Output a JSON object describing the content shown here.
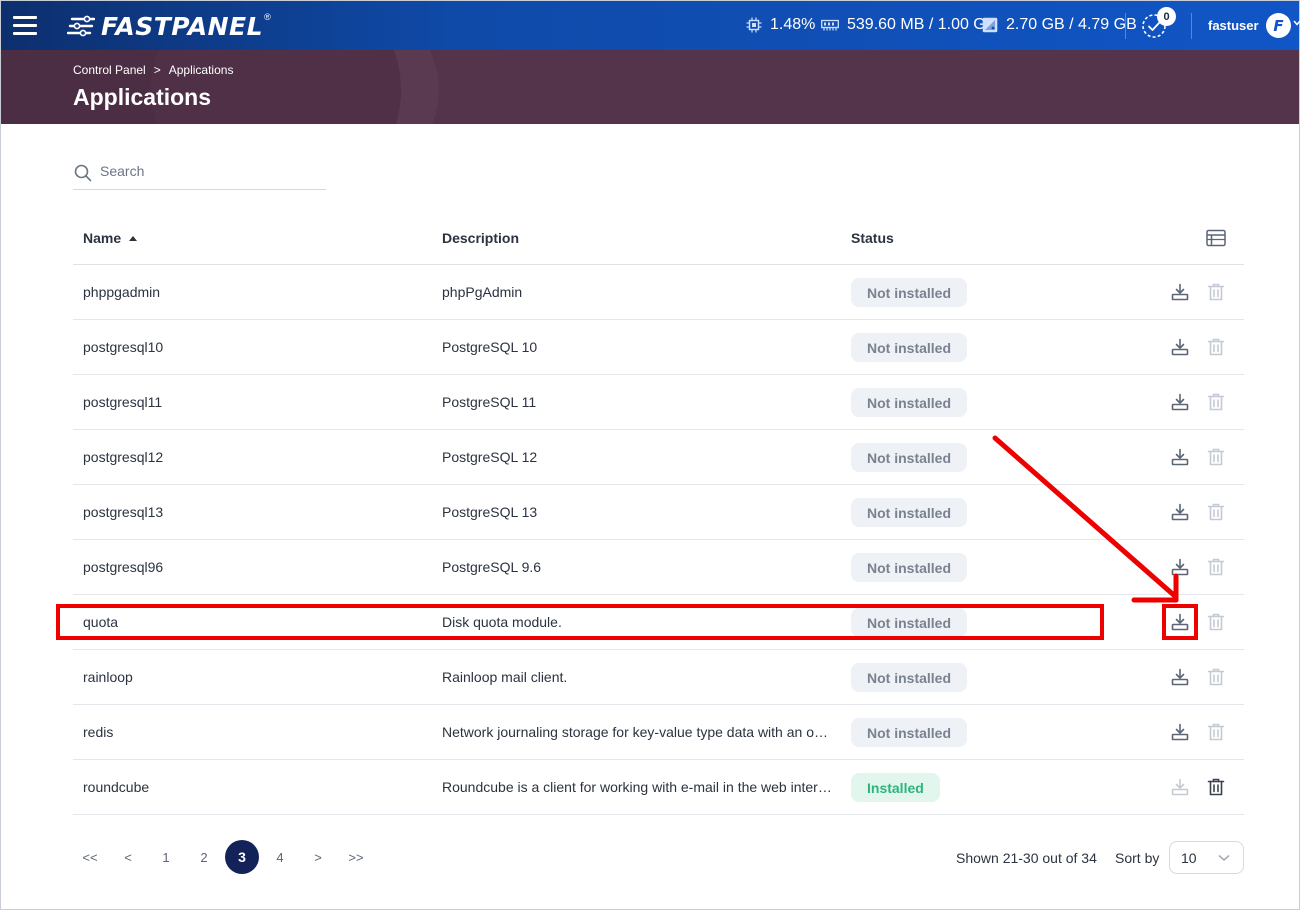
{
  "topbar": {
    "logo_text": "FASTPANEL",
    "logo_mark": "®",
    "cpu": "1.48%",
    "memory": "539.60 MB / 1.00 GB",
    "disk": "2.70 GB / 4.79 GB",
    "tasks_count": "0",
    "user_name": "fastuser",
    "avatar_letter": "F"
  },
  "breadcrumb": {
    "root": "Control Panel",
    "separator": ">",
    "current": "Applications"
  },
  "page_title": "Applications",
  "search": {
    "placeholder": "Search",
    "value": ""
  },
  "table": {
    "headers": {
      "name": "Name",
      "description": "Description",
      "status": "Status"
    },
    "rows": [
      {
        "name": "phppgadmin",
        "description": "phpPgAdmin",
        "status": "Not installed"
      },
      {
        "name": "postgresql10",
        "description": "PostgreSQL 10",
        "status": "Not installed"
      },
      {
        "name": "postgresql11",
        "description": "PostgreSQL 11",
        "status": "Not installed"
      },
      {
        "name": "postgresql12",
        "description": "PostgreSQL 12",
        "status": "Not installed"
      },
      {
        "name": "postgresql13",
        "description": "PostgreSQL 13",
        "status": "Not installed"
      },
      {
        "name": "postgresql96",
        "description": "PostgreSQL 9.6",
        "status": "Not installed"
      },
      {
        "name": "quota",
        "description": "Disk quota module.",
        "status": "Not installed"
      },
      {
        "name": "rainloop",
        "description": "Rainloop mail client.",
        "status": "Not installed"
      },
      {
        "name": "redis",
        "description": "Network journaling storage for key-value type data with an op…",
        "status": "Not installed"
      },
      {
        "name": "roundcube",
        "description": "Roundcube is a client for working with e-mail in the web inter…",
        "status": "Installed"
      }
    ]
  },
  "pagination": {
    "first": "<<",
    "prev": "<",
    "pages": [
      "1",
      "2",
      "3",
      "4"
    ],
    "current": "3",
    "next": ">",
    "last": ">>",
    "shown_text": "Shown 21-30 out of 34",
    "sort_by_label": "Sort by",
    "per_page": "10"
  },
  "colors": {
    "topbar_start": "#0d2f6e",
    "topbar_end": "#1155c6",
    "header_band": "#54344a",
    "active_page": "#13235a",
    "installed_text": "#2bb57d",
    "annotation_red": "#ee0000"
  },
  "icons": {
    "menu": "hamburger-icon",
    "cpu": "cpu-icon",
    "memory": "memory-icon",
    "disk": "disk-icon",
    "tasks": "tasks-clock-icon",
    "search": "search-icon",
    "columns": "table-columns-icon",
    "install": "download-icon",
    "delete": "trash-icon"
  }
}
